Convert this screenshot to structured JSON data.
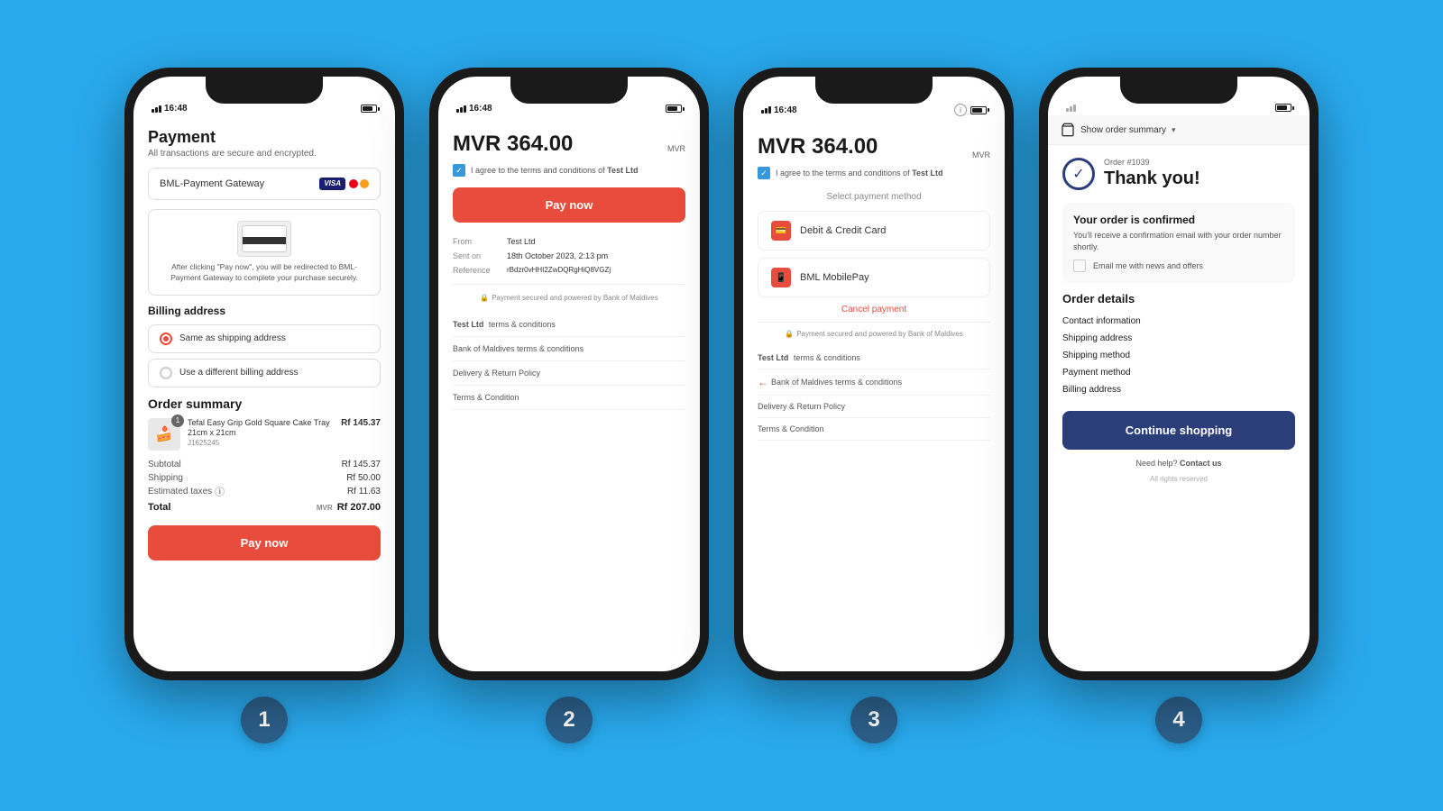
{
  "background": "#29aaee",
  "phones": [
    {
      "step": "1",
      "time": "16:48",
      "screen": {
        "title": "Payment",
        "subtitle": "All transactions are secure and encrypted.",
        "gateway": {
          "label": "BML-Payment Gateway",
          "cards": [
            "VISA",
            "MC"
          ]
        },
        "card_note": "After clicking \"Pay now\", you will be redirected to BML-Payment Gateway to complete your purchase securely.",
        "billing": {
          "title": "Billing address",
          "options": [
            {
              "label": "Same as shipping address",
              "selected": true
            },
            {
              "label": "Use a different billing address",
              "selected": false
            }
          ]
        },
        "order_summary": {
          "title": "Order summary",
          "item": {
            "name": "Tefal Easy Grip Gold Square Cake Tray 21cm x 21cm",
            "sku": "J1625245",
            "quantity": 1,
            "price": "Rf 145.37"
          },
          "lines": [
            {
              "label": "Subtotal",
              "value": "Rf 145.37"
            },
            {
              "label": "Shipping",
              "value": "Rf 50.00"
            },
            {
              "label": "Estimated taxes",
              "value": "Rf 11.63"
            }
          ],
          "total_label": "Total",
          "total_currency": "MVR",
          "total_value": "Rf 207.00"
        },
        "pay_button": "Pay now"
      }
    },
    {
      "step": "2",
      "time": "16:48",
      "screen": {
        "amount": "MVR 364.00",
        "currency": "MVR",
        "terms_text": "I agree to the terms and conditions of",
        "terms_company": "Test Ltd",
        "pay_button": "Pay now",
        "info_rows": [
          {
            "label": "From",
            "value": "Test Ltd"
          },
          {
            "label": "Sent on",
            "value": "18th October 2023, 2:13 pm"
          },
          {
            "label": "Reference",
            "value": "rBdzr0vHHI2ZwDQRgHiQ8VGZj"
          }
        ],
        "secure_text": "Payment secured and powered by Bank of Maldives",
        "links": [
          {
            "text": "Test Ltd",
            "bold": true,
            "suffix": "terms & conditions"
          },
          {
            "text": "Bank of Maldives terms & conditions"
          },
          {
            "text": "Delivery & Return Policy"
          },
          {
            "text": "Terms & Condition"
          }
        ]
      }
    },
    {
      "step": "3",
      "time": "16:48",
      "screen": {
        "amount": "MVR 364.00",
        "currency": "MVR",
        "terms_text": "I agree to the terms and conditions of",
        "terms_company": "Test Ltd",
        "select_method": "Select payment method",
        "methods": [
          {
            "label": "Debit & Credit Card"
          },
          {
            "label": "BML MobilePay"
          }
        ],
        "cancel": "Cancel payment",
        "secure_text": "Payment secured and powered by Bank of Maldives",
        "links": [
          {
            "text": "Test Ltd",
            "bold": true,
            "suffix": "terms & conditions",
            "has_back": false
          },
          {
            "text": "Bank of Maldives terms & conditions",
            "has_back": true
          },
          {
            "text": "Delivery & Return Policy"
          },
          {
            "text": "Terms & Condition"
          }
        ]
      }
    },
    {
      "step": "4",
      "time": "",
      "screen": {
        "show_order_summary": "Show order summary",
        "order_number": "Order #1039",
        "thank_you": "Thank you!",
        "confirmed_title": "Your order is confirmed",
        "confirmed_text": "You'll receive a confirmation email with your order number shortly.",
        "email_label": "Email me with news and offers",
        "details_title": "Order details",
        "detail_links": [
          "Contact information",
          "Shipping address",
          "Shipping method",
          "Payment method",
          "Billing address"
        ],
        "continue_button": "Continue shopping",
        "help_text": "Need help?",
        "help_link": "Contact us",
        "footer": "All rights reserved"
      }
    }
  ]
}
